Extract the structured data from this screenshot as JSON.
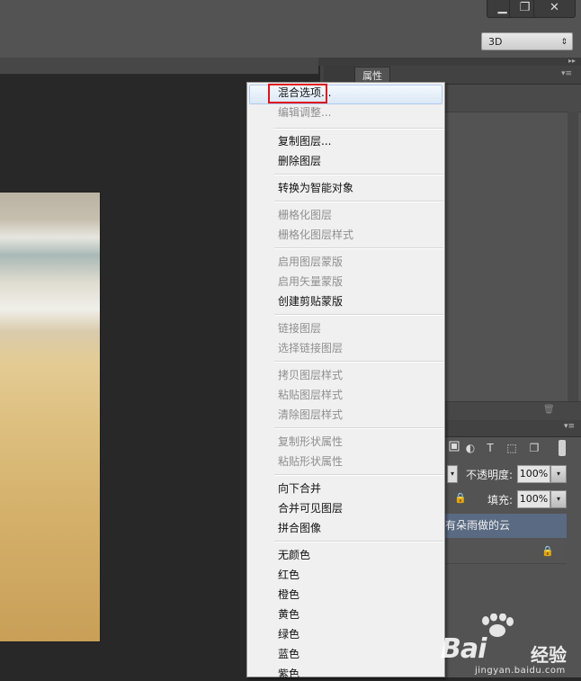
{
  "window": {
    "minimize_glyph": "▁",
    "restore_glyph": "❐",
    "close_glyph": "✕"
  },
  "options_bar": {
    "mode_select_value": "3D",
    "mode_select_arrow": "⇕"
  },
  "panels": {
    "collapse_glyph": "▸▸",
    "properties_tab": "属性",
    "menu_glyph": "▾≡",
    "trash_glyph": "🗑"
  },
  "layers": {
    "filter_icons": [
      "pixel-filter-icon",
      "adjustment-filter-icon",
      "type-filter-icon",
      "shape-filter-icon",
      "smart-object-filter-icon"
    ],
    "filter_glyphs": [
      "◐",
      "T",
      "⬚",
      "❐"
    ],
    "blend_arrow": "▾",
    "opacity_label": "不透明度:",
    "opacity_value": "100%",
    "fill_label": "填充:",
    "fill_value": "100%",
    "lock_glyph": "🔒",
    "dropdown_arrow": "▾",
    "selected_layer_name": "有朵雨做的云"
  },
  "context_menu": {
    "items": [
      {
        "label": "混合选项...",
        "enabled": true
      },
      {
        "label": "编辑调整...",
        "enabled": false
      },
      {
        "label": "复制图层...",
        "enabled": true
      },
      {
        "label": "删除图层",
        "enabled": true
      },
      {
        "label": "转换为智能对象",
        "enabled": true
      },
      {
        "label": "栅格化图层",
        "enabled": false
      },
      {
        "label": "栅格化图层样式",
        "enabled": false
      },
      {
        "label": "启用图层蒙版",
        "enabled": false
      },
      {
        "label": "启用矢量蒙版",
        "enabled": false
      },
      {
        "label": "创建剪贴蒙版",
        "enabled": true
      },
      {
        "label": "链接图层",
        "enabled": false
      },
      {
        "label": "选择链接图层",
        "enabled": false
      },
      {
        "label": "拷贝图层样式",
        "enabled": false
      },
      {
        "label": "粘贴图层样式",
        "enabled": false
      },
      {
        "label": "清除图层样式",
        "enabled": false
      },
      {
        "label": "复制形状属性",
        "enabled": false
      },
      {
        "label": "粘贴形状属性",
        "enabled": false
      },
      {
        "label": "向下合并",
        "enabled": true
      },
      {
        "label": "合并可见图层",
        "enabled": true
      },
      {
        "label": "拼合图像",
        "enabled": true
      },
      {
        "label": "无颜色",
        "enabled": true
      },
      {
        "label": "红色",
        "enabled": true
      },
      {
        "label": "橙色",
        "enabled": true
      },
      {
        "label": "黄色",
        "enabled": true
      },
      {
        "label": "绿色",
        "enabled": true
      },
      {
        "label": "蓝色",
        "enabled": true
      },
      {
        "label": "紫色",
        "enabled": true
      }
    ]
  },
  "watermark": {
    "brand": "Bai",
    "brand_tail": "经验",
    "url": "jingyan.baidu.com"
  },
  "colors": {
    "highlight_box": "#e0121b",
    "selected_layer_bg": "#596a82"
  }
}
